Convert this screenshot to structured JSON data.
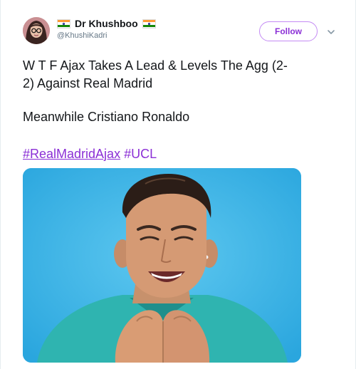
{
  "author": {
    "name": "Dr Khushboo",
    "handle": "@KhushiKadri"
  },
  "actions": {
    "follow_label": "Follow"
  },
  "tweet": {
    "line1": "W T F Ajax Takes A Lead & Levels The Agg (2-",
    "line2": "2) Against Real Madrid",
    "line3": "Meanwhile Cristiano Ronaldo",
    "hashtag1": "#RealMadridAjax",
    "hashtag2": "#UCL"
  },
  "icons": {
    "flag": "india-flag-icon",
    "caret": "chevron-down-icon"
  },
  "colors": {
    "link": "#8b2fd6",
    "follow_border": "#c48bf4",
    "handle": "#657786",
    "text": "#14171a",
    "media_background": "#40b5e6"
  }
}
